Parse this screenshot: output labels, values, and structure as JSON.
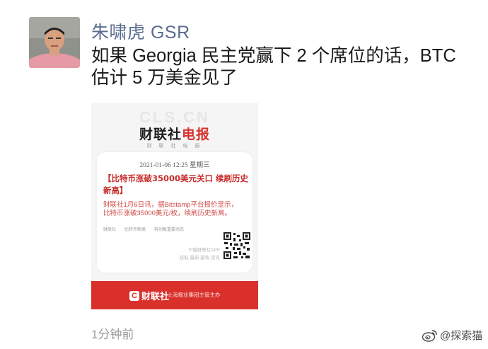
{
  "post": {
    "author": "朱啸虎 GSR",
    "text": "如果 Georgia 民主党赢下 2 个席位的话，BTC 估计 5 万美金见了",
    "time": "1分钟前"
  },
  "card": {
    "watermark": "CLS.CN",
    "brand_main": "财联社",
    "brand_highlight": "电报",
    "brand_sub": "财 联 社 电 报",
    "date": "2021-01-06 12:25 星期三",
    "headline": "【比特币涨破35000美元关口  续刷历史新高】",
    "body": "财联社1月6日讯，据Bitstamp平台报价显示，比特币涨破35000美元/枚，续刷历史新高。",
    "tags": [
      "财联社",
      "比特币新高",
      "科创板重要动态"
    ],
    "app_hint_line1": "下载财联社APP",
    "app_hint_line2": "获取 最新 最快 资讯",
    "footer_icon": "C",
    "footer_logo": "财联社",
    "footer_tagline": "·上海报业集团主管主办"
  },
  "watermark": {
    "icon": "weibo-icon",
    "label": "@探索猫"
  }
}
